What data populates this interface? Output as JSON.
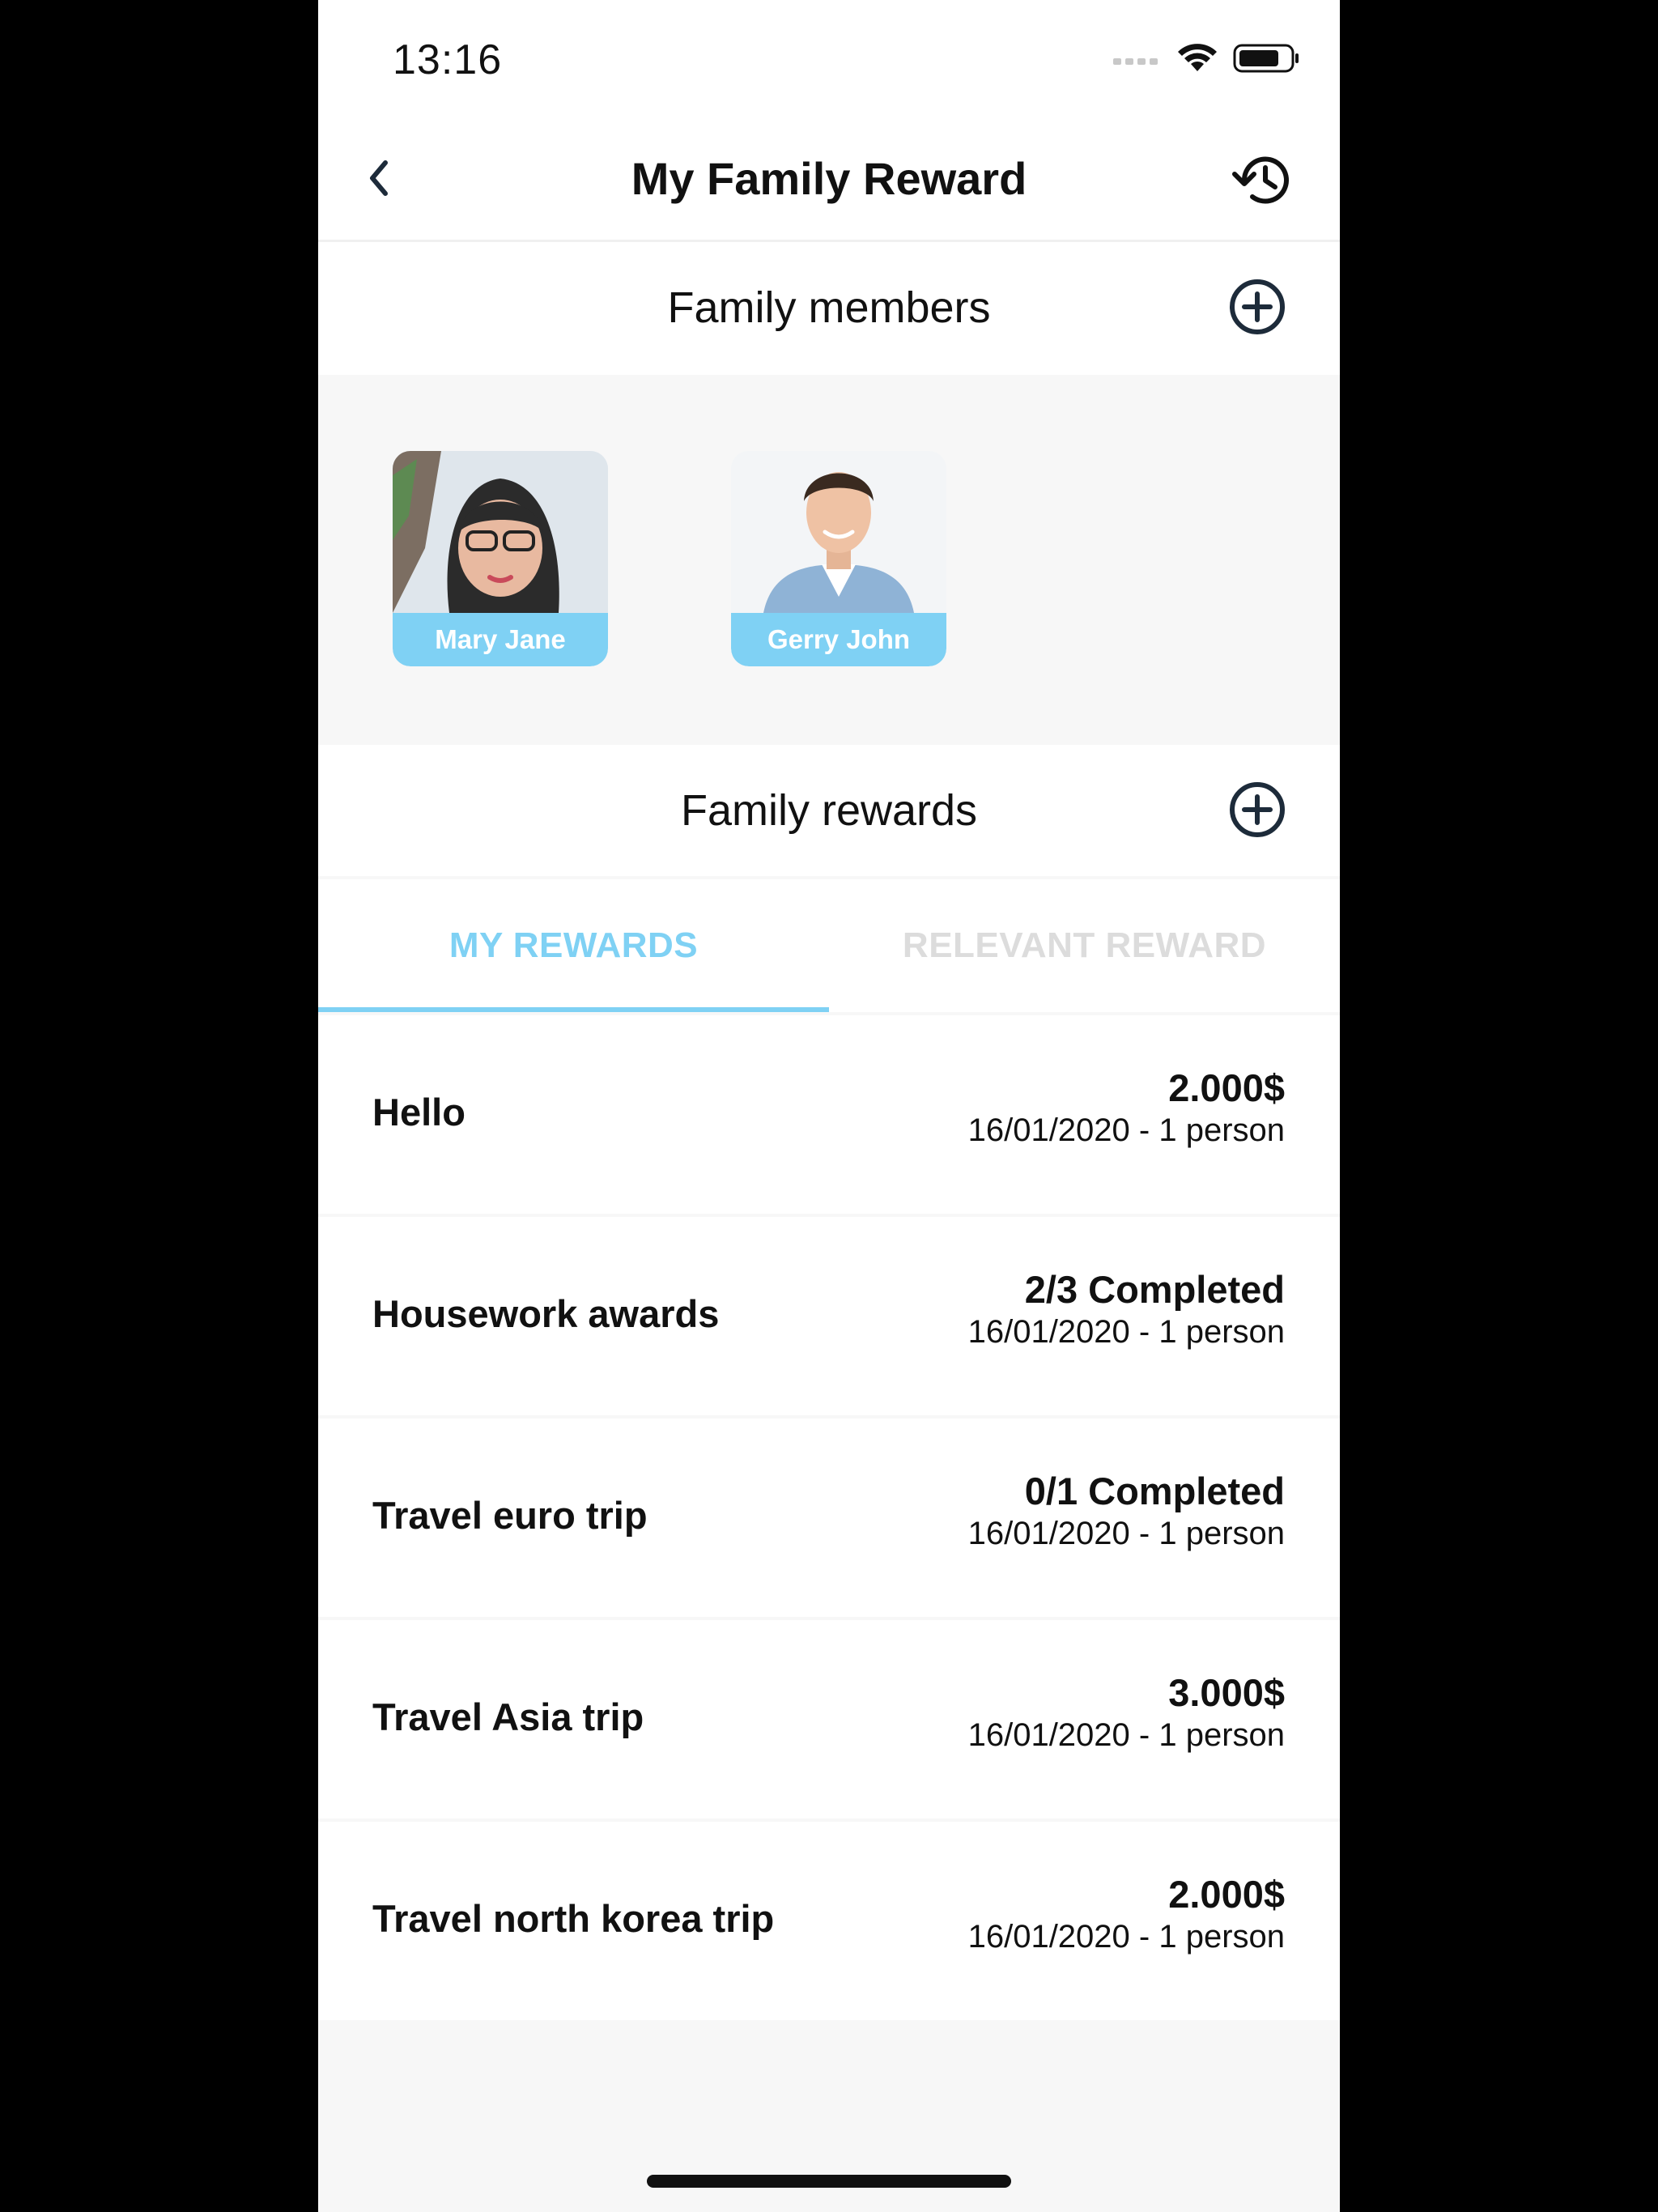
{
  "status_bar": {
    "time": "13:16"
  },
  "header": {
    "title": "My Family Reward",
    "back_icon": "chevron-left-icon",
    "history_icon": "history-icon"
  },
  "members_section": {
    "title": "Family members",
    "add_icon": "plus-circle-icon",
    "members": [
      {
        "name": "Mary Jane"
      },
      {
        "name": "Gerry John"
      }
    ]
  },
  "rewards_section": {
    "title": "Family rewards",
    "add_icon": "plus-circle-icon"
  },
  "tabs": {
    "active": "MY REWARDS",
    "inactive": "RELEVANT REWARD"
  },
  "rewards": [
    {
      "title": "Hello",
      "value": "2.000$",
      "meta": "16/01/2020 - 1 person"
    },
    {
      "title": "Housework awards",
      "value": "2/3 Completed",
      "meta": "16/01/2020 - 1 person"
    },
    {
      "title": "Travel euro trip",
      "value": "0/1 Completed",
      "meta": "16/01/2020 - 1 person"
    },
    {
      "title": "Travel Asia trip",
      "value": "3.000$",
      "meta": "16/01/2020 - 1 person"
    },
    {
      "title": "Travel north korea trip",
      "value": "2.000$",
      "meta": "16/01/2020 - 1 person"
    }
  ],
  "colors": {
    "accent": "#7fd1f4",
    "inactive_tab": "#dcdcdc",
    "icon_dark": "#1d2b3a"
  }
}
